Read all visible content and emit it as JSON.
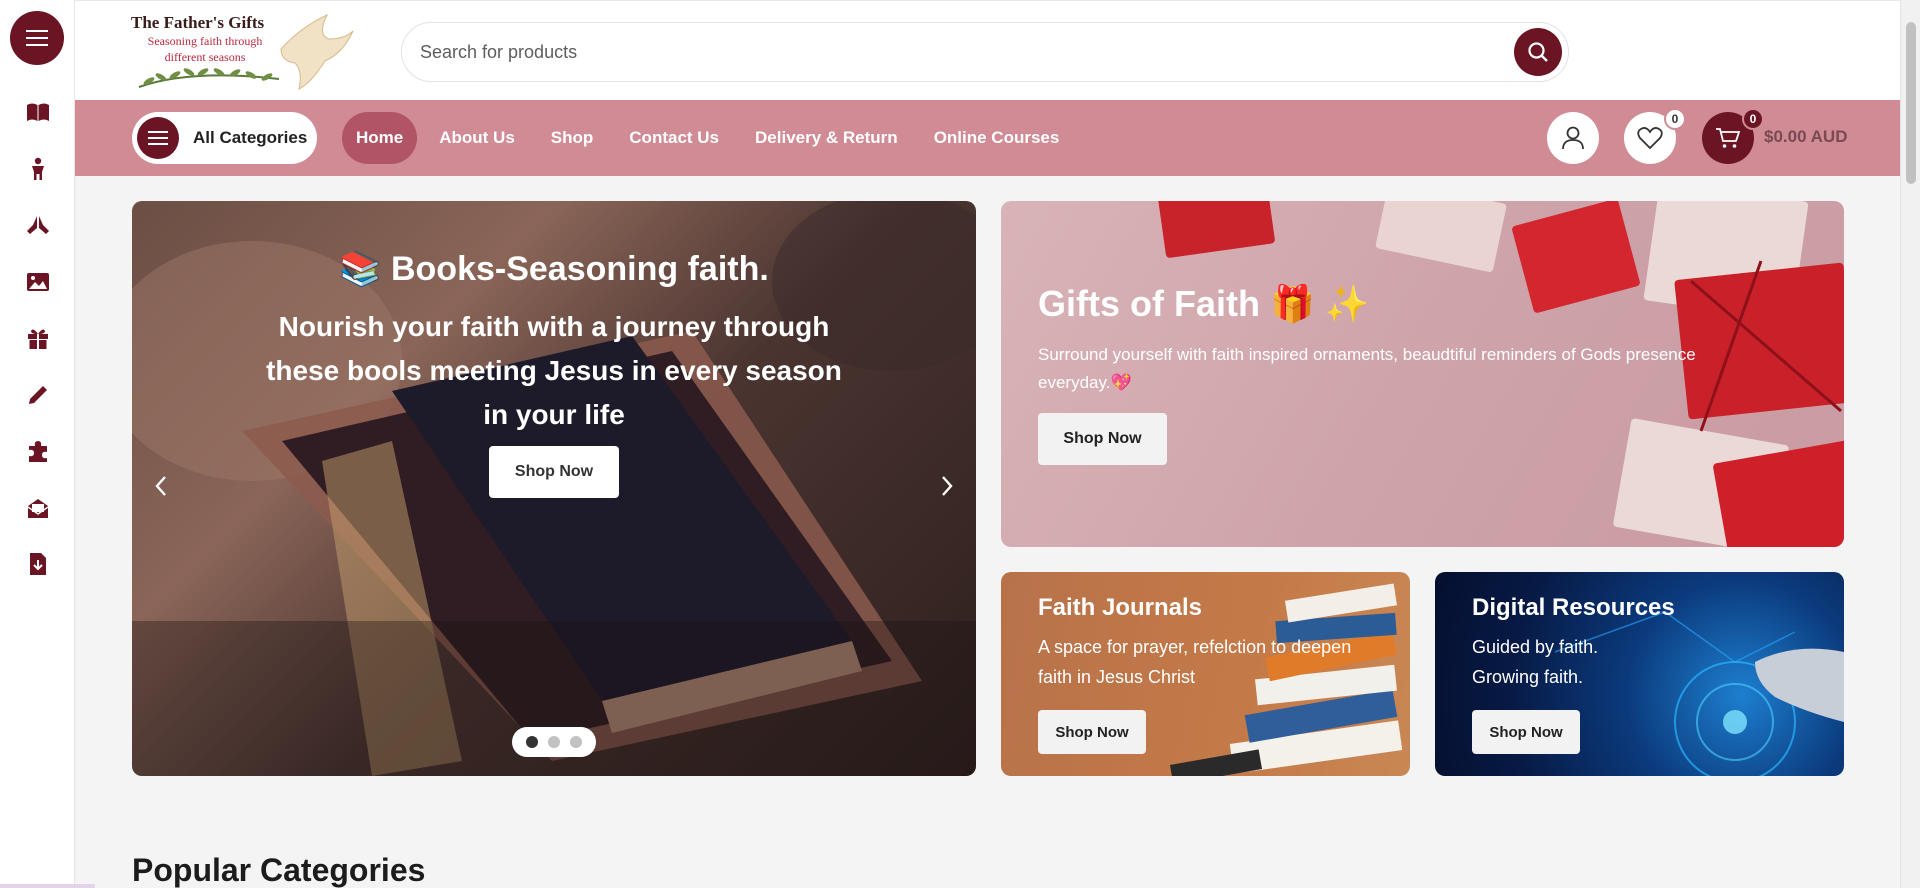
{
  "brand": {
    "title": "The Father's Gifts",
    "tagline": "Seasoning faith through different seasons",
    "primary_color": "#6b1424",
    "nav_color": "#d08b95"
  },
  "rail": {
    "menu_icon": "hamburger-icon",
    "items": [
      {
        "icon": "book-icon"
      },
      {
        "icon": "child-icon"
      },
      {
        "icon": "praying-hands-icon"
      },
      {
        "icon": "image-icon"
      },
      {
        "icon": "gift-icon"
      },
      {
        "icon": "pencil-icon"
      },
      {
        "icon": "puzzle-icon"
      },
      {
        "icon": "envelope-open-icon"
      },
      {
        "icon": "file-download-icon"
      }
    ]
  },
  "search": {
    "placeholder": "Search for products",
    "value": ""
  },
  "nav": {
    "all_categories": "All Categories",
    "links": [
      {
        "label": "Home",
        "active": true
      },
      {
        "label": "About Us",
        "active": false
      },
      {
        "label": "Shop",
        "active": false
      },
      {
        "label": "Contact Us",
        "active": false
      },
      {
        "label": "Delivery & Return",
        "active": false
      },
      {
        "label": "Online Courses",
        "active": false
      }
    ],
    "wishlist_count": "0",
    "cart_count": "0",
    "cart_total": "$0.00 AUD"
  },
  "hero": {
    "emoji": "📚",
    "heading": "Books-Seasoning faith.",
    "text": "Nourish your faith with a journey through these bools meeting Jesus in every season in your life",
    "button": "Shop Now",
    "slides": 3,
    "active_slide": 1
  },
  "gifts": {
    "title": "Gifts of Faith 🎁 ✨",
    "text": "Surround yourself with faith inspired ornaments, beaudtiful reminders of Gods presence everyday.💖",
    "button": "Shop Now"
  },
  "journals": {
    "title": "Faith Journals",
    "text": "A space for prayer, refelction to deepen faith in Jesus Christ",
    "button": "Shop Now"
  },
  "digital": {
    "title": "Digital Resources",
    "text": "Guided by faith. Growing faith.",
    "button": "Shop Now"
  },
  "popular": {
    "title": "Popular Categories"
  }
}
